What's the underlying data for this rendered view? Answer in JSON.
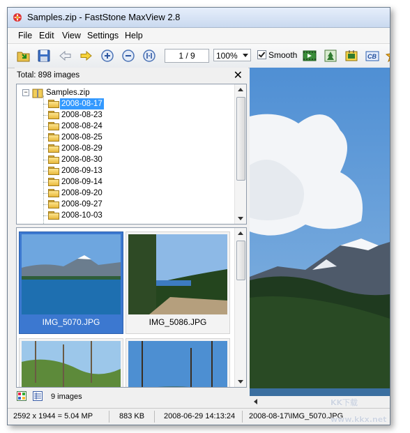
{
  "window": {
    "title": "Samples.zip - FastStone MaxView 2.8"
  },
  "menu": [
    "File",
    "Edit",
    "View",
    "Settings",
    "Help"
  ],
  "toolbar": {
    "page": "1 / 9",
    "zoom": "100%",
    "smooth_label": "Smooth",
    "smooth_checked": true
  },
  "panel": {
    "total": "Total: 898 images",
    "close": "✕",
    "tree_root": "Samples.zip",
    "tree_folders": [
      "2008-08-17",
      "2008-08-23",
      "2008-08-24",
      "2008-08-25",
      "2008-08-29",
      "2008-08-30",
      "2008-09-13",
      "2008-09-14",
      "2008-09-20",
      "2008-09-27",
      "2008-10-03"
    ],
    "selected_folder": "2008-08-17",
    "thumbnails": [
      "IMG_5070.JPG",
      "IMG_5086.JPG"
    ],
    "image_count": "9 images"
  },
  "status": {
    "dimensions": "2592 x 1944 = 5.04 MP",
    "size": "883 KB",
    "date": "2008-06-29 14:13:24",
    "path": "2008-08-17\\IMG_5070.JPG"
  },
  "watermark": "KK下载 www.kkx.net",
  "colors": {
    "selection": "#3399ff",
    "thumb_selection": "#3c78d0",
    "titlebar": "#c9d9ef"
  }
}
